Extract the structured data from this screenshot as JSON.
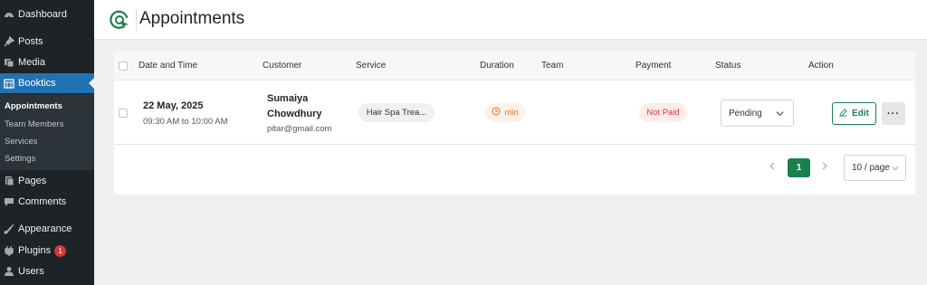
{
  "sidebar": {
    "items": [
      {
        "label": "Dashboard",
        "icon": "dashboard-icon"
      },
      {
        "label": "Posts",
        "icon": "pin-icon"
      },
      {
        "label": "Media",
        "icon": "media-icon"
      },
      {
        "label": "Booktics",
        "icon": "calendar-icon"
      },
      {
        "label": "Pages",
        "icon": "pages-icon"
      },
      {
        "label": "Comments",
        "icon": "comment-icon"
      },
      {
        "label": "Appearance",
        "icon": "brush-icon"
      },
      {
        "label": "Plugins",
        "icon": "plugin-icon",
        "badge": "1"
      },
      {
        "label": "Users",
        "icon": "user-icon"
      }
    ],
    "submenu": [
      "Appointments",
      "Team Members",
      "Services",
      "Settings"
    ],
    "accent": "#2271b1"
  },
  "header": {
    "title": "Appointments",
    "logo_color": "#1a7f4b"
  },
  "table": {
    "columns": [
      "Date and Time",
      "Customer",
      "Service",
      "Duration",
      "Team",
      "Payment",
      "Status",
      "Action"
    ],
    "rows": [
      {
        "date": "22 May, 2025",
        "time": "09:30 AM to 10:00 AM",
        "customer_name": "Sumaiya Chowdhury",
        "customer_email": "pitar@gmail.com",
        "service": "Hair Spa Trea...",
        "duration": "min",
        "team": "",
        "payment": "Not Paid",
        "status": "Pending",
        "edit_label": "Edit",
        "more_label": "···"
      }
    ]
  },
  "pagination": {
    "current": "1",
    "page_size": "10 / page"
  },
  "colors": {
    "primary": "#1a7f4b",
    "danger": "#d63638",
    "warning": "#e76f2f"
  }
}
